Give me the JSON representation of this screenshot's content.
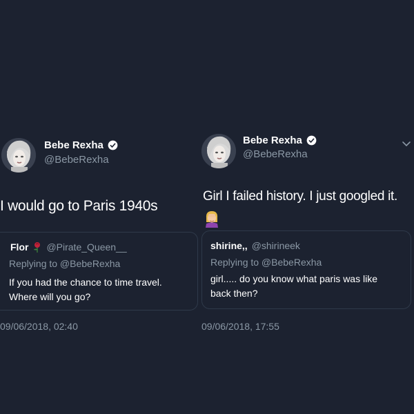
{
  "left_tweet": {
    "author_name": "Bebe Rexha",
    "author_handle": "@BebeRexha",
    "text": "I would go to Paris 1940s",
    "quote": {
      "name": "Flor",
      "handle": "@Pirate_Queen__",
      "replying_to": "Replying to @BebeRexha",
      "lines": [
        "If you had the chance to time travel.",
        "Where will you go?"
      ]
    },
    "timestamp": "09/06/2018, 02:40"
  },
  "right_tweet": {
    "author_name": "Bebe Rexha",
    "author_handle": "@BebeRexha",
    "text": "Girl I failed history. I just googled it.",
    "emoji": "woman-facepalming-emoji",
    "quote": {
      "name": "shirine,,",
      "handle": "@shirineek",
      "replying_to": "Replying to @BebeRexha",
      "lines": [
        "girl..... do you know what paris was like",
        "back then?"
      ]
    },
    "timestamp": "09/06/2018, 17:55"
  },
  "colors": {
    "background": "#1c2230",
    "text_primary": "#ffffff",
    "text_secondary": "#8b98a5",
    "card_border": "#2f3a4a",
    "verified_badge": "#ffffff"
  },
  "icons": [
    "verified-badge-icon",
    "rose-icon",
    "chevron-down-icon",
    "woman-facepalming-emoji"
  ]
}
